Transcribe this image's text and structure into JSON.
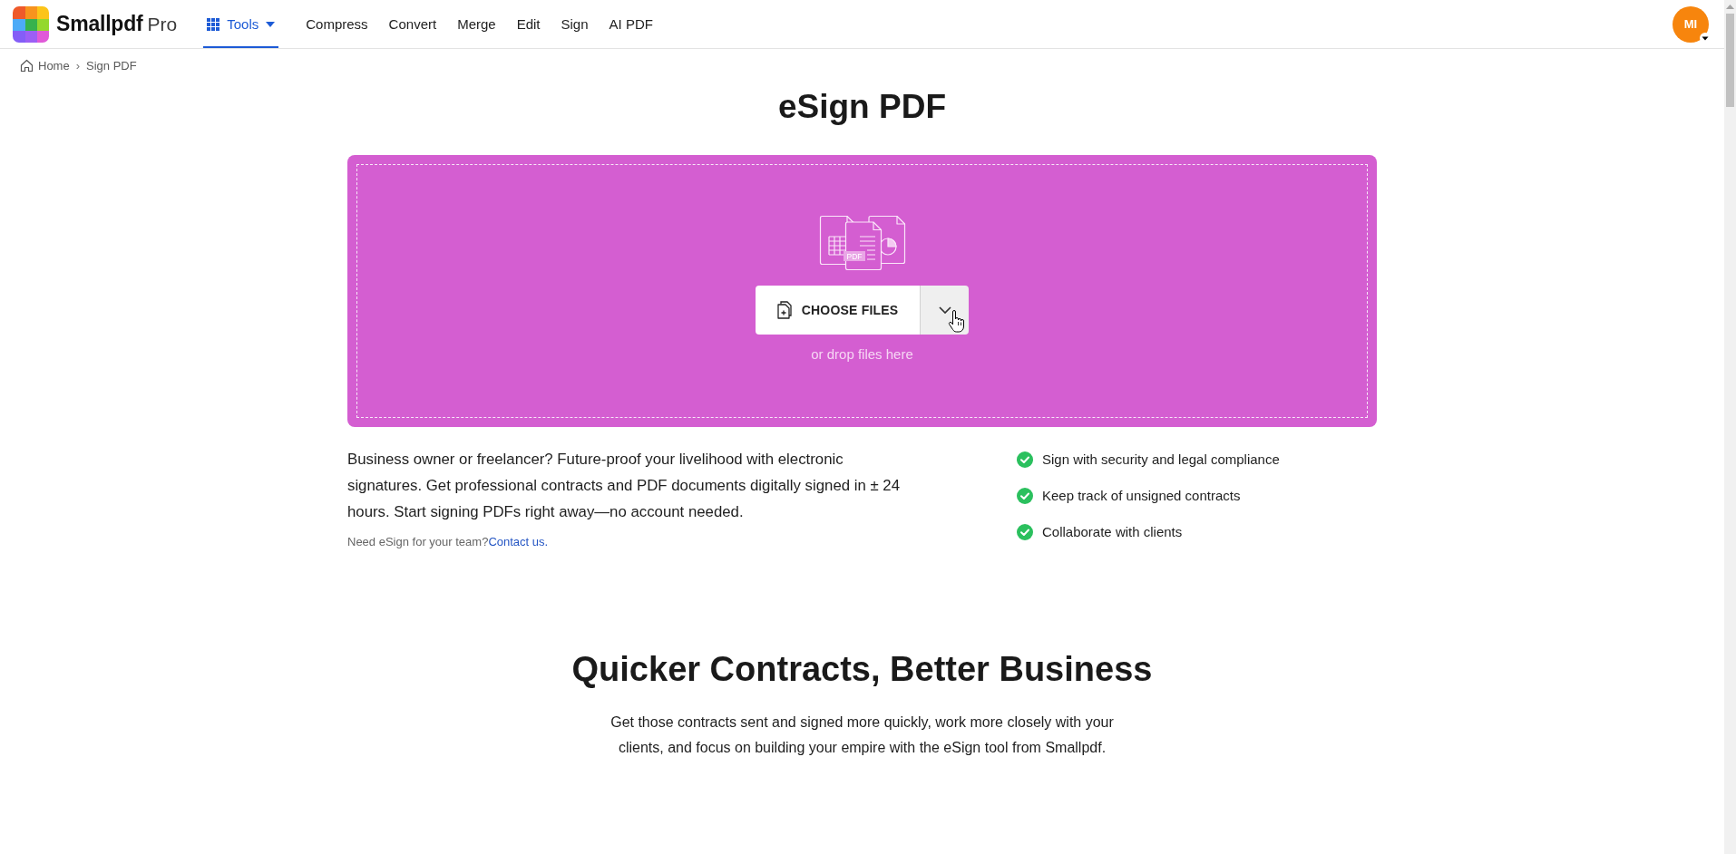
{
  "header": {
    "logo": {
      "name": "Smallpdf",
      "plan": "Pro"
    },
    "nav": [
      {
        "kind": "menu",
        "label": "Tools",
        "selected": true
      },
      {
        "kind": "link",
        "label": "Compress",
        "selected": false
      },
      {
        "kind": "link",
        "label": "Convert",
        "selected": false
      },
      {
        "kind": "link",
        "label": "Merge",
        "selected": false
      },
      {
        "kind": "link",
        "label": "Edit",
        "selected": false
      },
      {
        "kind": "link",
        "label": "Sign",
        "selected": false
      },
      {
        "kind": "link",
        "label": "AI PDF",
        "selected": false
      }
    ],
    "avatar": {
      "initials": "MI"
    }
  },
  "breadcrumb": {
    "items": [
      {
        "kind": "root",
        "label": "Home"
      },
      {
        "kind": "current",
        "label": "Sign PDF"
      }
    ],
    "separator": "›"
  },
  "title": "eSign PDF",
  "dropzone": {
    "illustration_label": "PDF",
    "button": "CHOOSE FILES",
    "hint": "or drop files here"
  },
  "description": {
    "text": "Business owner or freelancer? Future-proof your livelihood with electronic signatures. Get professional contracts and PDF documents digitally signed in ± 24 hours. Start signing PDFs right away—no account needed.",
    "note": "Need eSign for your team?",
    "link": "Contact us."
  },
  "features": [
    "Sign with security and legal compliance",
    "Keep track of unsigned contracts",
    "Collaborate with clients"
  ],
  "section": {
    "title": "Quicker Contracts, Better Business",
    "text": "Get those contracts sent and signed more quickly, work more closely with your clients, and focus on building your empire with the eSign tool from Smallpdf."
  }
}
